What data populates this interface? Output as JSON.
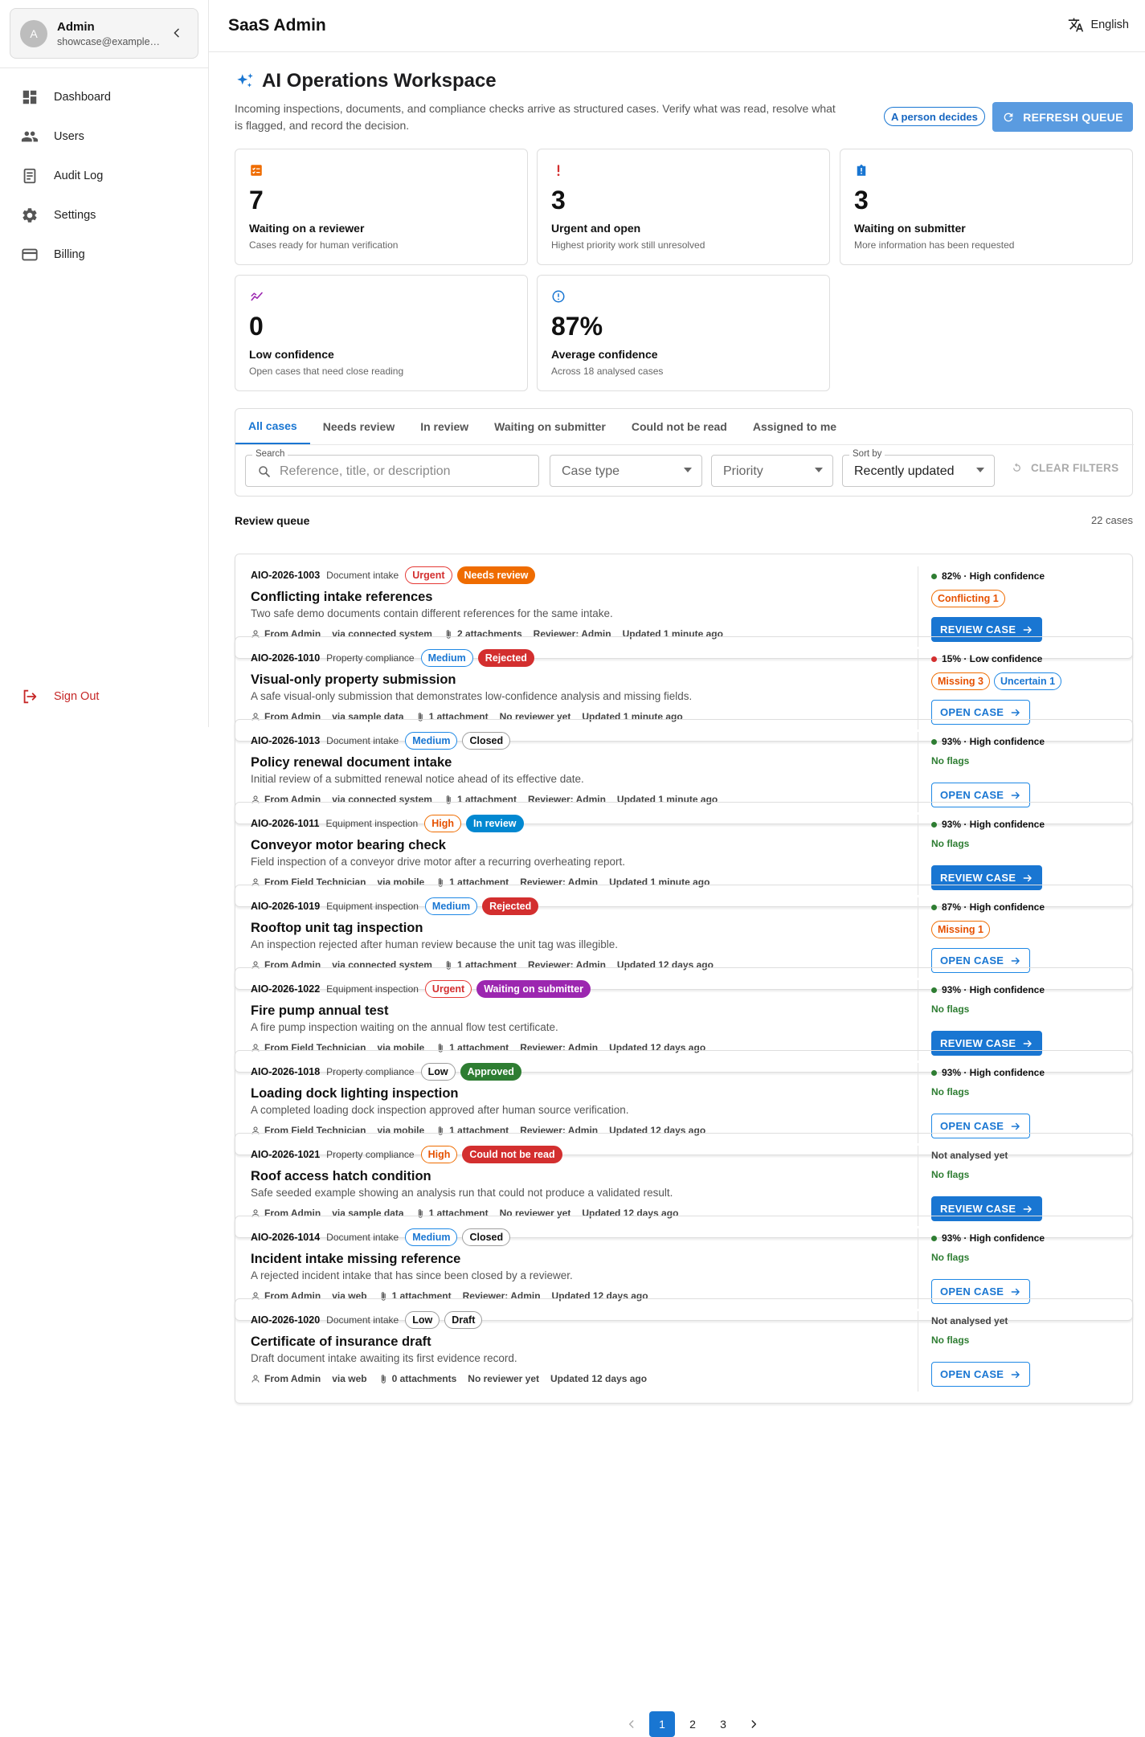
{
  "sidebar": {
    "user": {
      "initial": "A",
      "name": "Admin",
      "email": "showcase@example.com"
    },
    "items": [
      {
        "label": "Dashboard",
        "icon": "dashboard-icon"
      },
      {
        "label": "Users",
        "icon": "users-icon"
      },
      {
        "label": "Audit Log",
        "icon": "audit-log-icon"
      },
      {
        "label": "Settings",
        "icon": "gear-icon"
      },
      {
        "label": "Billing",
        "icon": "credit-card-icon"
      }
    ],
    "signout_label": "Sign Out"
  },
  "header": {
    "title": "SaaS Admin",
    "language": "English"
  },
  "page": {
    "title": "AI Operations Workspace",
    "description": "Incoming inspections, documents, and compliance checks arrive as structured cases. Verify what was read, resolve what is flagged, and record the decision.",
    "person_chip": "A person decides",
    "refresh_label": "REFRESH QUEUE"
  },
  "stats": [
    {
      "value": "7",
      "label": "Waiting on a reviewer",
      "sub": "Cases ready for human verification",
      "icon": "checklist-icon",
      "color": "#ef6c00"
    },
    {
      "value": "3",
      "label": "Urgent and open",
      "sub": "Highest priority work still unresolved",
      "icon": "exclamation-icon",
      "color": "#d32f2f"
    },
    {
      "value": "3",
      "label": "Waiting on submitter",
      "sub": "More information has been requested",
      "icon": "info-badge-icon",
      "color": "#1976d2"
    },
    {
      "value": "0",
      "label": "Low confidence",
      "sub": "Open cases that need close reading",
      "icon": "trend-icon",
      "color": "#9c27b0"
    },
    {
      "value": "87%",
      "label": "Average confidence",
      "sub": "Across 18 analysed cases",
      "icon": "info-circle-icon",
      "color": "#1976d2"
    }
  ],
  "tabs": [
    "All cases",
    "Needs review",
    "In review",
    "Waiting on submitter",
    "Could not be read",
    "Assigned to me"
  ],
  "filters": {
    "search_label": "Search",
    "search_placeholder": "Reference, title, or description",
    "case_type": "Case type",
    "priority": "Priority",
    "sort_label": "Sort by",
    "sort_value": "Recently updated",
    "clear_label": "CLEAR FILTERS"
  },
  "queue": {
    "title": "Review queue",
    "count": "22 cases"
  },
  "cases": [
    {
      "ref": "AIO-2026-1003",
      "type": "Document intake",
      "priority": "Urgent",
      "pclass": "urgent",
      "status": "Needs review",
      "sclass": "needs_review",
      "title": "Conflicting intake references",
      "desc": "Two safe demo documents contain different references for the same intake.",
      "from": "From Admin",
      "via": "via connected system",
      "attach": "2 attachments",
      "reviewer": "Reviewer: Admin",
      "updated": "Updated 1 minute ago",
      "conf": "82% · High confidence",
      "dot": "#2e7d32",
      "flags": [
        {
          "text": "Conflicting 1",
          "style": "orange"
        }
      ],
      "flag_text": "",
      "action": "REVIEW CASE",
      "action_style": "review"
    },
    {
      "ref": "AIO-2026-1010",
      "type": "Property compliance",
      "priority": "Medium",
      "pclass": "medium",
      "status": "Rejected",
      "sclass": "rejected",
      "title": "Visual-only property submission",
      "desc": "A safe visual-only submission that demonstrates low-confidence analysis and missing fields.",
      "from": "From Admin",
      "via": "via sample data",
      "attach": "1 attachment",
      "reviewer": "No reviewer yet",
      "updated": "Updated 1 minute ago",
      "conf": "15% · Low confidence",
      "dot": "#d32f2f",
      "flags": [
        {
          "text": "Missing 3",
          "style": "orange"
        },
        {
          "text": "Uncertain 1",
          "style": "blue"
        }
      ],
      "flag_text": "",
      "action": "OPEN CASE",
      "action_style": "open"
    },
    {
      "ref": "AIO-2026-1013",
      "type": "Document intake",
      "priority": "Medium",
      "pclass": "medium",
      "status": "Closed",
      "sclass": "closed",
      "title": "Policy renewal document intake",
      "desc": "Initial review of a submitted renewal notice ahead of its effective date.",
      "from": "From Admin",
      "via": "via connected system",
      "attach": "1 attachment",
      "reviewer": "Reviewer: Admin",
      "updated": "Updated 1 minute ago",
      "conf": "93% · High confidence",
      "dot": "#2e7d32",
      "flags": [],
      "flag_text": "No flags",
      "action": "OPEN CASE",
      "action_style": "open"
    },
    {
      "ref": "AIO-2026-1011",
      "type": "Equipment inspection",
      "priority": "High",
      "pclass": "high",
      "status": "In review",
      "sclass": "in_review",
      "title": "Conveyor motor bearing check",
      "desc": "Field inspection of a conveyor drive motor after a recurring overheating report.",
      "from": "From Field Technician",
      "via": "via mobile",
      "attach": "1 attachment",
      "reviewer": "Reviewer: Admin",
      "updated": "Updated 1 minute ago",
      "conf": "93% · High confidence",
      "dot": "#2e7d32",
      "flags": [],
      "flag_text": "No flags",
      "action": "REVIEW CASE",
      "action_style": "review"
    },
    {
      "ref": "AIO-2026-1019",
      "type": "Equipment inspection",
      "priority": "Medium",
      "pclass": "medium",
      "status": "Rejected",
      "sclass": "rejected",
      "title": "Rooftop unit tag inspection",
      "desc": "An inspection rejected after human review because the unit tag was illegible.",
      "from": "From Admin",
      "via": "via connected system",
      "attach": "1 attachment",
      "reviewer": "Reviewer: Admin",
      "updated": "Updated 12 days ago",
      "conf": "87% · High confidence",
      "dot": "#2e7d32",
      "flags": [
        {
          "text": "Missing 1",
          "style": "orange"
        }
      ],
      "flag_text": "",
      "action": "OPEN CASE",
      "action_style": "open"
    },
    {
      "ref": "AIO-2026-1022",
      "type": "Equipment inspection",
      "priority": "Urgent",
      "pclass": "urgent",
      "status": "Waiting on submitter",
      "sclass": "waiting",
      "title": "Fire pump annual test",
      "desc": "A fire pump inspection waiting on the annual flow test certificate.",
      "from": "From Field Technician",
      "via": "via mobile",
      "attach": "1 attachment",
      "reviewer": "Reviewer: Admin",
      "updated": "Updated 12 days ago",
      "conf": "93% · High confidence",
      "dot": "#2e7d32",
      "flags": [],
      "flag_text": "No flags",
      "action": "REVIEW CASE",
      "action_style": "review"
    },
    {
      "ref": "AIO-2026-1018",
      "type": "Property compliance",
      "priority": "Low",
      "pclass": "low",
      "status": "Approved",
      "sclass": "approved",
      "title": "Loading dock lighting inspection",
      "desc": "A completed loading dock inspection approved after human source verification.",
      "from": "From Field Technician",
      "via": "via mobile",
      "attach": "1 attachment",
      "reviewer": "Reviewer: Admin",
      "updated": "Updated 12 days ago",
      "conf": "93% · High confidence",
      "dot": "#2e7d32",
      "flags": [],
      "flag_text": "No flags",
      "action": "OPEN CASE",
      "action_style": "open"
    },
    {
      "ref": "AIO-2026-1021",
      "type": "Property compliance",
      "priority": "High",
      "pclass": "high",
      "status": "Could not be read",
      "sclass": "unread",
      "title": "Roof access hatch condition",
      "desc": "Safe seeded example showing an analysis run that could not produce a validated result.",
      "from": "From Admin",
      "via": "via sample data",
      "attach": "1 attachment",
      "reviewer": "No reviewer yet",
      "updated": "Updated 12 days ago",
      "conf": "Not analysed yet",
      "dot": "",
      "flags": [],
      "flag_text": "No flags",
      "action": "REVIEW CASE",
      "action_style": "review"
    },
    {
      "ref": "AIO-2026-1014",
      "type": "Document intake",
      "priority": "Medium",
      "pclass": "medium",
      "status": "Closed",
      "sclass": "closed",
      "title": "Incident intake missing reference",
      "desc": "A rejected incident intake that has since been closed by a reviewer.",
      "from": "From Admin",
      "via": "via web",
      "attach": "1 attachment",
      "reviewer": "Reviewer: Admin",
      "updated": "Updated 12 days ago",
      "conf": "93% · High confidence",
      "dot": "#2e7d32",
      "flags": [],
      "flag_text": "No flags",
      "action": "OPEN CASE",
      "action_style": "open"
    },
    {
      "ref": "AIO-2026-1020",
      "type": "Document intake",
      "priority": "Low",
      "pclass": "low",
      "status": "Draft",
      "sclass": "draft",
      "title": "Certificate of insurance draft",
      "desc": "Draft document intake awaiting its first evidence record.",
      "from": "From Admin",
      "via": "via web",
      "attach": "0 attachments",
      "reviewer": "No reviewer yet",
      "updated": "Updated 12 days ago",
      "conf": "Not analysed yet",
      "dot": "",
      "flags": [],
      "flag_text": "No flags",
      "action": "OPEN CASE",
      "action_style": "open"
    }
  ],
  "pagination": {
    "pages": [
      "1",
      "2",
      "3"
    ],
    "current": "1"
  }
}
